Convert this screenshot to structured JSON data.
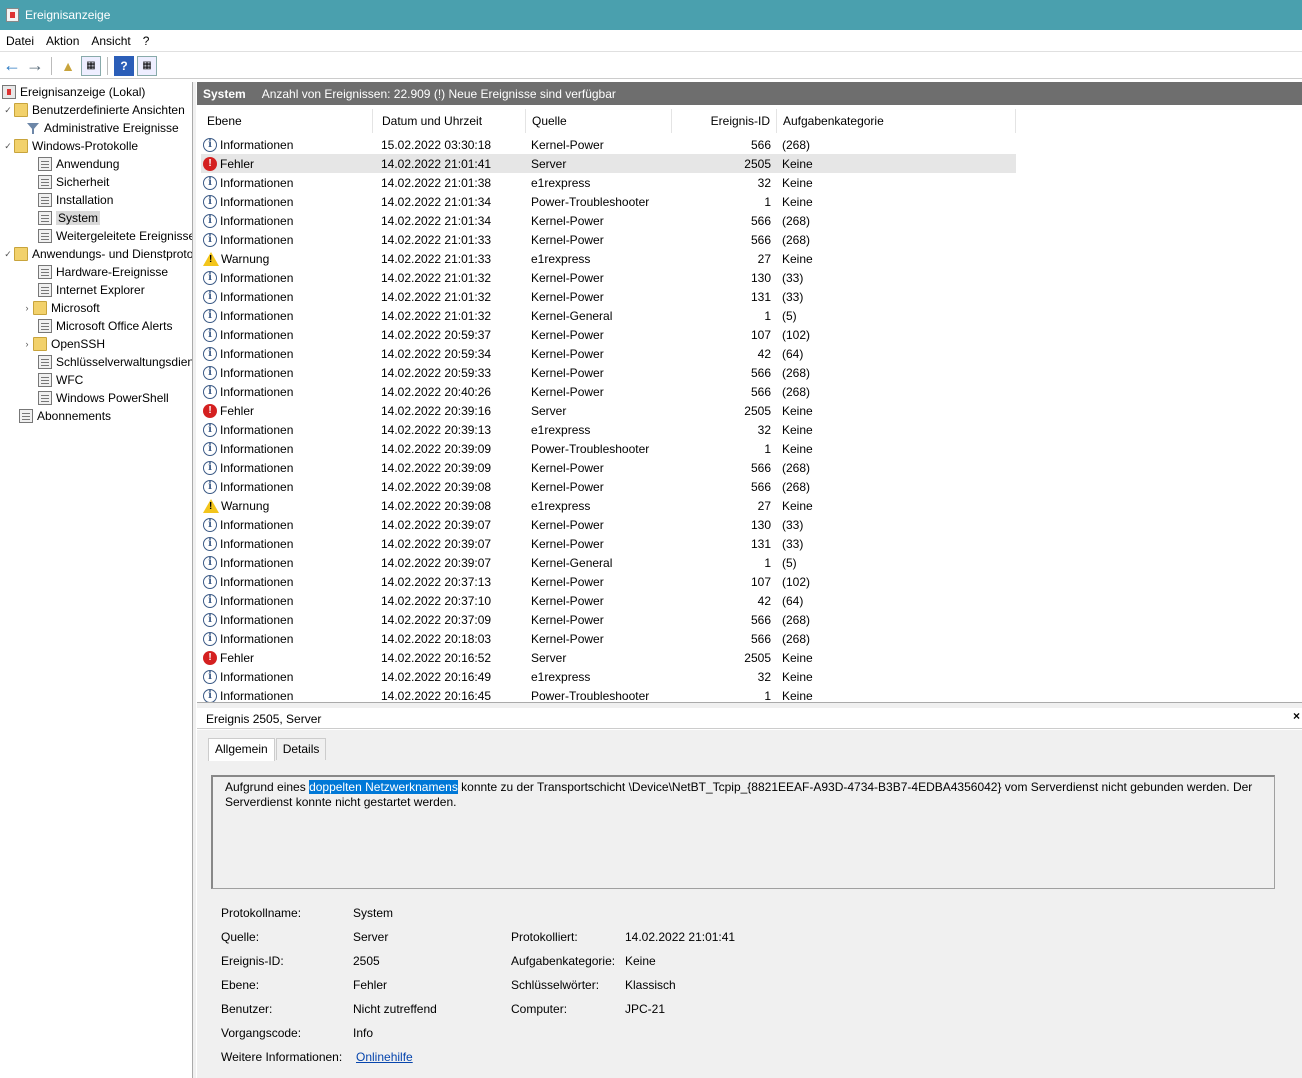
{
  "window": {
    "title": "Ereignisanzeige"
  },
  "menu": [
    {
      "label": "Datei"
    },
    {
      "label": "Aktion"
    },
    {
      "label": "Ansicht"
    },
    {
      "label": "?"
    }
  ],
  "tree": {
    "root": "Ereignisanzeige (Lokal)",
    "custom_views": "Benutzerdefinierte Ansichten",
    "admin_events": "Administrative Ereignisse",
    "windows_logs": "Windows-Protokolle",
    "app": "Anwendung",
    "security": "Sicherheit",
    "setup": "Installation",
    "system": "System",
    "forwarded": "Weitergeleitete Ereignisse",
    "app_services": "Anwendungs- und Dienstprotokolle",
    "hardware": "Hardware-Ereignisse",
    "ie": "Internet Explorer",
    "microsoft": "Microsoft",
    "office": "Microsoft Office Alerts",
    "openssh": "OpenSSH",
    "keymgmt": "Schlüsselverwaltungsdienst",
    "wfc": "WFC",
    "powershell": "Windows PowerShell",
    "subscriptions": "Abonnements"
  },
  "header": {
    "log": "System",
    "count_text": "Anzahl von Ereignissen: 22.909 (!) Neue Ereignisse sind verfügbar"
  },
  "columns": {
    "level": "Ebene",
    "date": "Datum und Uhrzeit",
    "source": "Quelle",
    "id": "Ereignis-ID",
    "category": "Aufgabenkategorie"
  },
  "events": [
    {
      "type": "info",
      "level": "Informationen",
      "date": "15.02.2022 03:30:18",
      "source": "Kernel-Power",
      "id": "566",
      "cat": "(268)"
    },
    {
      "type": "err",
      "level": "Fehler",
      "date": "14.02.2022 21:01:41",
      "source": "Server",
      "id": "2505",
      "cat": "Keine"
    },
    {
      "type": "info",
      "level": "Informationen",
      "date": "14.02.2022 21:01:38",
      "source": "e1rexpress",
      "id": "32",
      "cat": "Keine"
    },
    {
      "type": "info",
      "level": "Informationen",
      "date": "14.02.2022 21:01:34",
      "source": "Power-Troubleshooter",
      "id": "1",
      "cat": "Keine"
    },
    {
      "type": "info",
      "level": "Informationen",
      "date": "14.02.2022 21:01:34",
      "source": "Kernel-Power",
      "id": "566",
      "cat": "(268)"
    },
    {
      "type": "info",
      "level": "Informationen",
      "date": "14.02.2022 21:01:33",
      "source": "Kernel-Power",
      "id": "566",
      "cat": "(268)"
    },
    {
      "type": "warn",
      "level": "Warnung",
      "date": "14.02.2022 21:01:33",
      "source": "e1rexpress",
      "id": "27",
      "cat": "Keine"
    },
    {
      "type": "info",
      "level": "Informationen",
      "date": "14.02.2022 21:01:32",
      "source": "Kernel-Power",
      "id": "130",
      "cat": "(33)"
    },
    {
      "type": "info",
      "level": "Informationen",
      "date": "14.02.2022 21:01:32",
      "source": "Kernel-Power",
      "id": "131",
      "cat": "(33)"
    },
    {
      "type": "info",
      "level": "Informationen",
      "date": "14.02.2022 21:01:32",
      "source": "Kernel-General",
      "id": "1",
      "cat": "(5)"
    },
    {
      "type": "info",
      "level": "Informationen",
      "date": "14.02.2022 20:59:37",
      "source": "Kernel-Power",
      "id": "107",
      "cat": "(102)"
    },
    {
      "type": "info",
      "level": "Informationen",
      "date": "14.02.2022 20:59:34",
      "source": "Kernel-Power",
      "id": "42",
      "cat": "(64)"
    },
    {
      "type": "info",
      "level": "Informationen",
      "date": "14.02.2022 20:59:33",
      "source": "Kernel-Power",
      "id": "566",
      "cat": "(268)"
    },
    {
      "type": "info",
      "level": "Informationen",
      "date": "14.02.2022 20:40:26",
      "source": "Kernel-Power",
      "id": "566",
      "cat": "(268)"
    },
    {
      "type": "err",
      "level": "Fehler",
      "date": "14.02.2022 20:39:16",
      "source": "Server",
      "id": "2505",
      "cat": "Keine"
    },
    {
      "type": "info",
      "level": "Informationen",
      "date": "14.02.2022 20:39:13",
      "source": "e1rexpress",
      "id": "32",
      "cat": "Keine"
    },
    {
      "type": "info",
      "level": "Informationen",
      "date": "14.02.2022 20:39:09",
      "source": "Power-Troubleshooter",
      "id": "1",
      "cat": "Keine"
    },
    {
      "type": "info",
      "level": "Informationen",
      "date": "14.02.2022 20:39:09",
      "source": "Kernel-Power",
      "id": "566",
      "cat": "(268)"
    },
    {
      "type": "info",
      "level": "Informationen",
      "date": "14.02.2022 20:39:08",
      "source": "Kernel-Power",
      "id": "566",
      "cat": "(268)"
    },
    {
      "type": "warn",
      "level": "Warnung",
      "date": "14.02.2022 20:39:08",
      "source": "e1rexpress",
      "id": "27",
      "cat": "Keine"
    },
    {
      "type": "info",
      "level": "Informationen",
      "date": "14.02.2022 20:39:07",
      "source": "Kernel-Power",
      "id": "130",
      "cat": "(33)"
    },
    {
      "type": "info",
      "level": "Informationen",
      "date": "14.02.2022 20:39:07",
      "source": "Kernel-Power",
      "id": "131",
      "cat": "(33)"
    },
    {
      "type": "info",
      "level": "Informationen",
      "date": "14.02.2022 20:39:07",
      "source": "Kernel-General",
      "id": "1",
      "cat": "(5)"
    },
    {
      "type": "info",
      "level": "Informationen",
      "date": "14.02.2022 20:37:13",
      "source": "Kernel-Power",
      "id": "107",
      "cat": "(102)"
    },
    {
      "type": "info",
      "level": "Informationen",
      "date": "14.02.2022 20:37:10",
      "source": "Kernel-Power",
      "id": "42",
      "cat": "(64)"
    },
    {
      "type": "info",
      "level": "Informationen",
      "date": "14.02.2022 20:37:09",
      "source": "Kernel-Power",
      "id": "566",
      "cat": "(268)"
    },
    {
      "type": "info",
      "level": "Informationen",
      "date": "14.02.2022 20:18:03",
      "source": "Kernel-Power",
      "id": "566",
      "cat": "(268)"
    },
    {
      "type": "err",
      "level": "Fehler",
      "date": "14.02.2022 20:16:52",
      "source": "Server",
      "id": "2505",
      "cat": "Keine"
    },
    {
      "type": "info",
      "level": "Informationen",
      "date": "14.02.2022 20:16:49",
      "source": "e1rexpress",
      "id": "32",
      "cat": "Keine"
    },
    {
      "type": "info",
      "level": "Informationen",
      "date": "14.02.2022 20:16:45",
      "source": "Power-Troubleshooter",
      "id": "1",
      "cat": "Keine"
    }
  ],
  "selected_index": 1,
  "detail": {
    "title": "Ereignis 2505, Server",
    "close": "×",
    "tab_general": "Allgemein",
    "tab_details": "Details",
    "msg_before": "Aufgrund eines ",
    "msg_highlight": "doppelten Netzwerknamens",
    "msg_after": " konnte zu der Transportschicht \\Device\\NetBT_Tcpip_{8821EEAF-A93D-4734-B3B7-4EDBA4356042} vom Serverdienst nicht gebunden werden. Der Serverdienst konnte nicht gestartet werden.",
    "labels": {
      "logname": "Protokollname:",
      "source": "Quelle:",
      "eventid": "Ereignis-ID:",
      "level": "Ebene:",
      "user": "Benutzer:",
      "opcode": "Vorgangscode:",
      "moreinfo": "Weitere Informationen:",
      "logged": "Protokolliert:",
      "category": "Aufgabenkategorie:",
      "keywords": "Schlüsselwörter:",
      "computer": "Computer:"
    },
    "values": {
      "logname": "System",
      "source": "Server",
      "eventid": "2505",
      "level": "Fehler",
      "user": "Nicht zutreffend",
      "opcode": "Info",
      "moreinfo": "Onlinehilfe",
      "logged": "14.02.2022 21:01:41",
      "category": "Keine",
      "keywords": "Klassisch",
      "computer": "JPC-21"
    }
  }
}
